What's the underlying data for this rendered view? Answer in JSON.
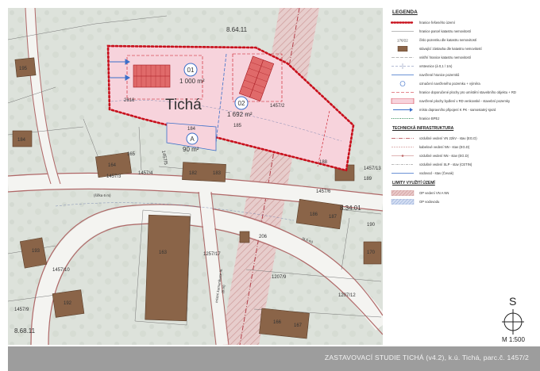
{
  "map": {
    "parcel_labels": {
      "p195": "195",
      "p184a": "184",
      "p165": "165",
      "p164": "164",
      "p1457_3": "1457/3",
      "p1457_4": "1457/4",
      "p1457_5": "1457/5",
      "p184b": "184",
      "p2616": "2616",
      "p182": "182",
      "p183": "183",
      "p185": "185",
      "p1457_2": "1457/2",
      "p188": "188",
      "p1457_13": "1457/13",
      "p189": "189",
      "p1457_6": "1457/6",
      "p186": "186",
      "p187": "187",
      "p190": "190",
      "p170": "170",
      "p206": "206",
      "p163": "163",
      "p1257_17": "1257/17",
      "p1207_9": "1207/9",
      "p1207_12": "1207/12",
      "p193": "193",
      "p1457_10": "1457/10",
      "p192": "192",
      "p1457_9": "1457/9",
      "p166": "166",
      "p167": "167"
    },
    "grid_labels": {
      "g1": "8.64.11",
      "g2": "8.34.01",
      "g3": "8.68.11"
    },
    "place_name": "Tichá",
    "plot_01": {
      "id": "01",
      "area": "1 000 m²"
    },
    "plot_02": {
      "id": "02",
      "area": "1 692 m²"
    },
    "plot_A": {
      "id": "A",
      "area": "90 m²"
    },
    "street_labels": {
      "s1": "místní komunikace III.",
      "s2": "(šířka 6 m)",
      "s3": "(6,5 m)",
      "s4": "(6 m)"
    }
  },
  "legend": {
    "title": "LEGENDA",
    "items": [
      "hranice řešeného území",
      "hranice parcel katastru nemovitostí",
      "číslo pozemku dle katastru nemovitostí",
      "stávající zástavba dle katastru nemovitostí",
      "vnitřní hranice katastru nemovitostí",
      "vrstevnice (á 0,1 / 1m)",
      "navržené hranice pozemků",
      "označení navrženého pozemku + výměra",
      "hranice doporučené plochy pro umístění stavebního objektu + RD",
      "navržené plochy bydlení v RD venkovské - stavební pozemky",
      "místo dopravního připojení K PK - samostatný sjezd",
      "hranice BPEJ"
    ],
    "tech_title": "TECHNICKÁ INFRASTRUKTURA",
    "tech_items": [
      "vzdušné vedení VN 22kV - stav (EG.D)",
      "kabelové vedení NN - stav (EG.D)",
      "vzdušné vedení NN - stav (EG.D)",
      "vzdušné vedení SLP - stav (CETIN)",
      "vodovod - stav (Čevak)"
    ],
    "limits_title": "LIMITY VYUŽITÍ ÚZEMÍ",
    "limits_items": [
      "OP vedení VN A NN",
      "OP vodovodu"
    ]
  },
  "north": {
    "letter": "S",
    "scale": "M 1:500"
  },
  "footer": {
    "text": "ZASTAVOVACÍ STUDIE TICHÁ (v4.2), k.ú. Tichá, parc.č. 1457/2"
  },
  "colors": {
    "boundary": "#c8101c",
    "proposed_plot": "#f7d3dc",
    "building": "#8a6448",
    "background": "#dfe4dd",
    "road_casing": "#b06868",
    "footer": "#9d9d9d"
  }
}
